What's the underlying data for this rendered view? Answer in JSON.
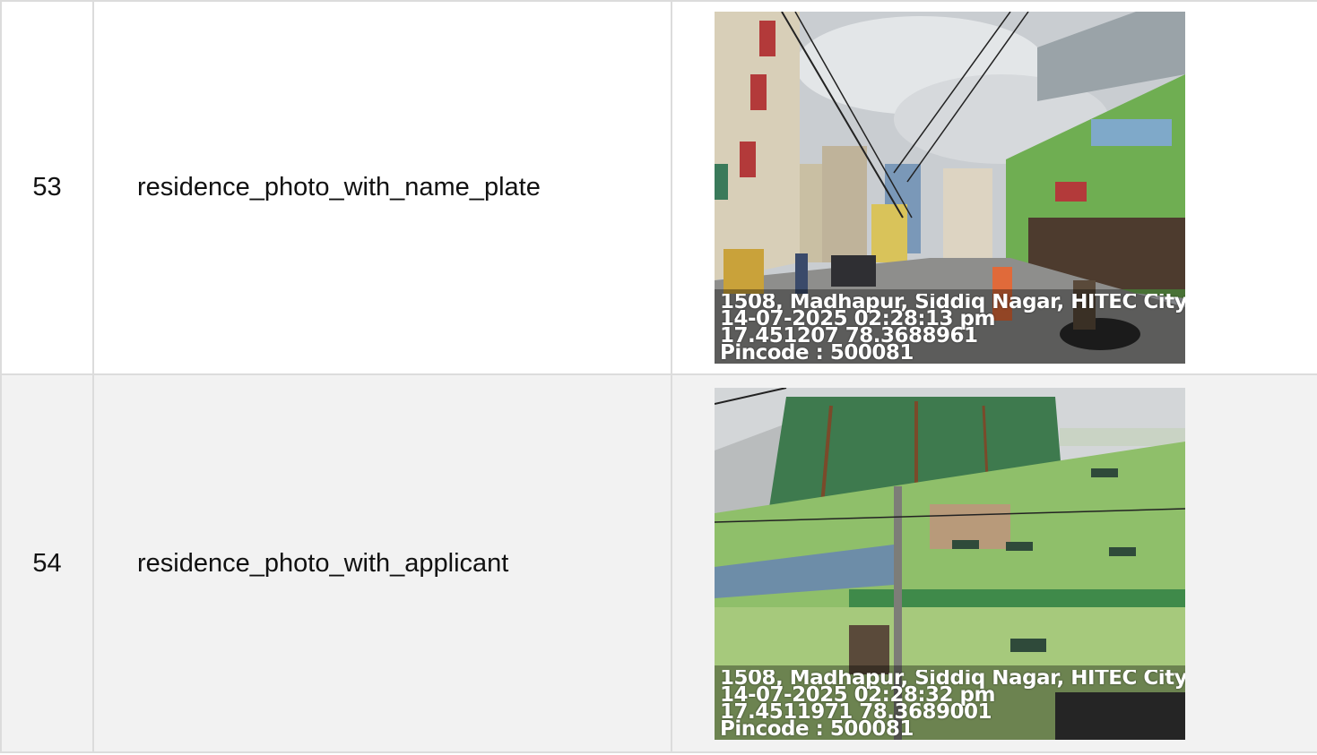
{
  "rows": [
    {
      "number": "53",
      "label": "residence_photo_with_name_plate",
      "photo": {
        "address": "1508, Madhapur, Siddiq Nagar, HITEC City, ..",
        "datetime": "14-07-2025 02:28:13 pm",
        "coordinates": "17.451207 78.3688961",
        "pincode": "Pincode : 500081"
      }
    },
    {
      "number": "54",
      "label": "residence_photo_with_applicant",
      "photo": {
        "address": "1508, Madhapur, Siddiq Nagar, HITEC City, ..",
        "datetime": "14-07-2025 02:28:32 pm",
        "coordinates": "17.4511971 78.3689001",
        "pincode": "Pincode : 500081"
      }
    }
  ]
}
